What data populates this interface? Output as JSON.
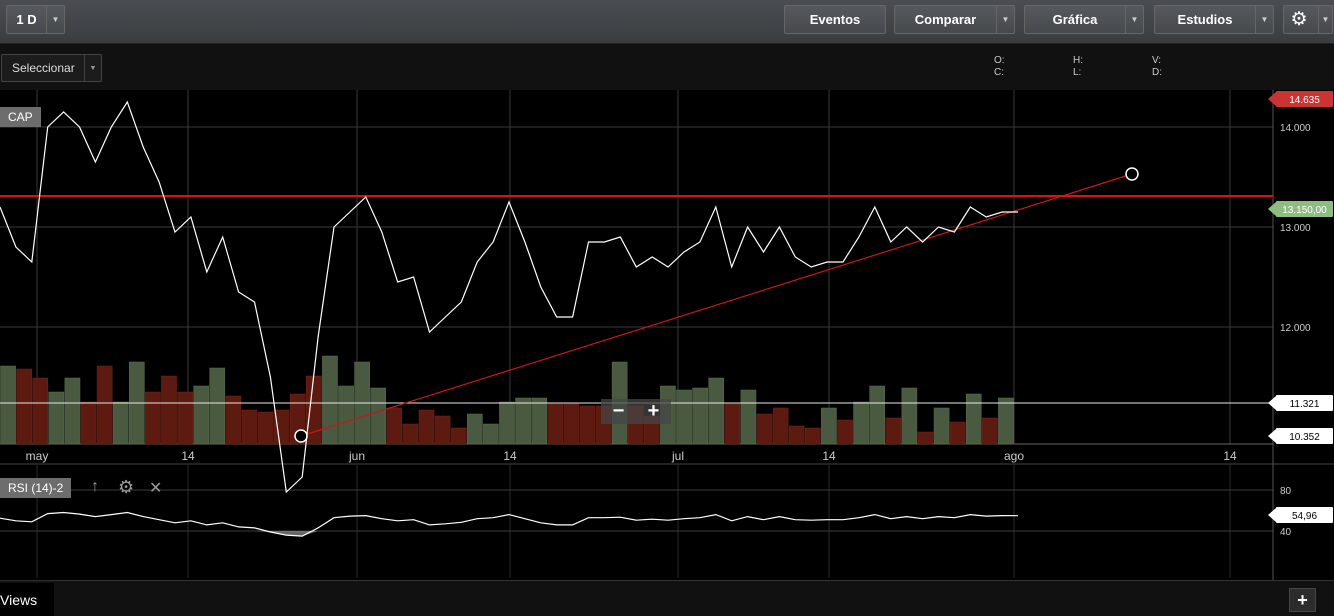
{
  "toolbar": {
    "period": "1 D",
    "events": "Eventos",
    "compare": "Comparar",
    "chart": "Gráfica",
    "studies": "Estudios"
  },
  "subbar": {
    "select": "Seleccionar",
    "ohlc": {
      "o": "O:",
      "c": "C:",
      "h": "H:",
      "l": "L:",
      "v": "V:",
      "d": "D:"
    }
  },
  "main_chart": {
    "symbol": "CAP"
  },
  "rsi_panel": {
    "label": "RSI (14)-2"
  },
  "bottom": {
    "views": "Views"
  },
  "colors": {
    "up_volume": "#4a5a40",
    "down_volume": "#5c1a10",
    "price_line": "#ffffff",
    "resistance": "#e01010",
    "trend": "#c81818",
    "high_badge": "#cc3333",
    "last_badge": "#8fbc80"
  },
  "chart_data": [
    {
      "type": "line",
      "title": "CAP",
      "x_tick_labels": [
        "may",
        "14",
        "jun",
        "14",
        "jul",
        "14",
        "ago",
        "14"
      ],
      "y_tick_labels": [
        "14.000",
        "13.000",
        "12.000"
      ],
      "ylim": [
        10.352,
        14.635
      ],
      "price_badges": {
        "high": "14.635",
        "last": "13.150,00",
        "line_level": "11.321",
        "low": "10.352"
      },
      "series": [
        {
          "values": [
            13.2,
            12.8,
            12.65,
            14.0,
            14.15,
            14.0,
            13.65,
            14.0,
            14.25,
            13.8,
            13.45,
            12.95,
            13.1,
            12.55,
            12.9,
            12.35,
            12.25,
            11.5,
            10.35,
            10.5,
            11.9,
            13.0,
            13.15,
            13.3,
            12.95,
            12.45,
            12.5,
            11.95,
            12.1,
            12.25,
            12.65,
            12.85,
            13.25,
            12.85,
            12.4,
            12.1,
            12.1,
            12.85,
            12.85,
            12.9,
            12.6,
            12.7,
            12.6,
            12.75,
            12.85,
            13.2,
            12.6,
            13.0,
            12.75,
            13.0,
            12.7,
            12.6,
            12.65,
            12.65,
            12.9,
            13.2,
            12.85,
            13.0,
            12.85,
            13.0,
            12.95,
            13.2,
            13.1,
            13.15,
            13.15
          ]
        }
      ],
      "volume": {
        "values": [
          78,
          75,
          66,
          52,
          66,
          42,
          78,
          42,
          82,
          52,
          68,
          52,
          58,
          76,
          48,
          34,
          32,
          34,
          50,
          68,
          88,
          58,
          82,
          56,
          36,
          20,
          34,
          28,
          16,
          30,
          20,
          42,
          46,
          46,
          40,
          40,
          38,
          38,
          82,
          38,
          28,
          58,
          54,
          56,
          66,
          40,
          54,
          30,
          36,
          18,
          16,
          36,
          24,
          42,
          58,
          26,
          56,
          12,
          36,
          22,
          50,
          26,
          46
        ],
        "up": [
          true,
          false,
          false,
          true,
          true,
          false,
          false,
          true,
          true,
          false,
          false,
          false,
          true,
          true,
          false,
          false,
          false,
          false,
          false,
          false,
          true,
          true,
          true,
          true,
          false,
          false,
          false,
          false,
          false,
          true,
          true,
          true,
          true,
          true,
          false,
          false,
          false,
          false,
          true,
          false,
          false,
          true,
          true,
          true,
          true,
          false,
          true,
          false,
          false,
          false,
          false,
          true,
          false,
          true,
          true,
          false,
          true,
          false,
          true,
          false,
          true,
          false,
          true
        ]
      }
    },
    {
      "type": "line",
      "title": "RSI (14)-2",
      "y_tick_labels": [
        "80",
        "40"
      ],
      "last_value_label": "54,96",
      "ylim": [
        20,
        100
      ],
      "series": [
        {
          "values": [
            52.5,
            50,
            49,
            57,
            58,
            56.5,
            54,
            56,
            58,
            54,
            51,
            48,
            50,
            46,
            48,
            44,
            43,
            39,
            36,
            35,
            43,
            53,
            54.5,
            55,
            52,
            50,
            51,
            46,
            47,
            48.5,
            52,
            53,
            56,
            52,
            48,
            46,
            46,
            53,
            53,
            53.5,
            50.5,
            51.5,
            50.5,
            52,
            53,
            56,
            50,
            54,
            51,
            54,
            51,
            50.5,
            51,
            51,
            53,
            56,
            52,
            54,
            52,
            54,
            53,
            56,
            54.5,
            55,
            54.96
          ]
        }
      ]
    }
  ]
}
